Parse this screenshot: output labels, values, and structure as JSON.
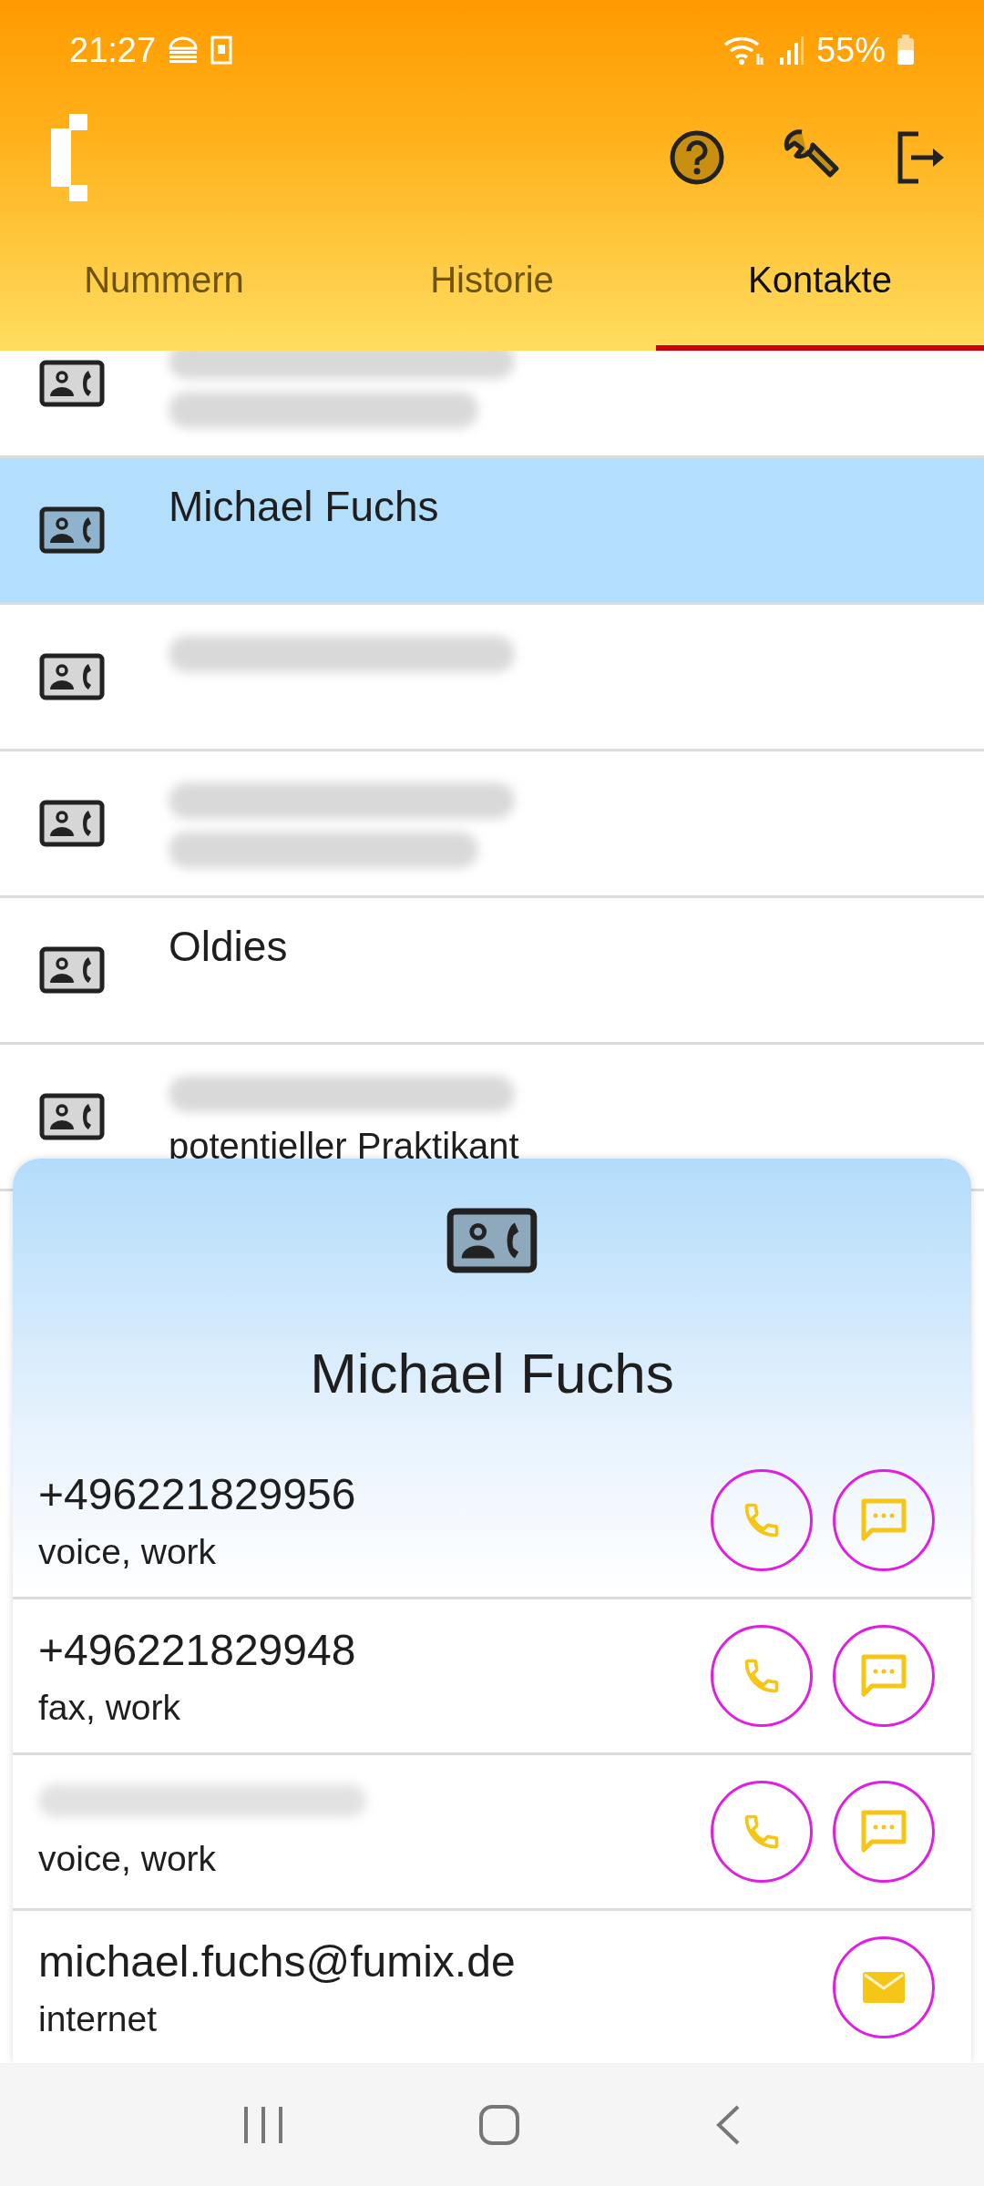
{
  "status_bar": {
    "time": "21:27",
    "battery": "55%"
  },
  "tabs": [
    {
      "label": "Nummern",
      "selected": false
    },
    {
      "label": "Historie",
      "selected": false
    },
    {
      "label": "Kontakte",
      "selected": true
    }
  ],
  "contacts": [
    {
      "selected": false,
      "lines": [
        {
          "kind": "blurred"
        },
        {
          "kind": "blurred"
        }
      ]
    },
    {
      "selected": true,
      "lines": [
        {
          "kind": "text",
          "text": "Michael Fuchs"
        }
      ]
    },
    {
      "selected": false,
      "lines": [
        {
          "kind": "blurred"
        }
      ]
    },
    {
      "selected": false,
      "lines": [
        {
          "kind": "blurred"
        },
        {
          "kind": "blurred"
        }
      ]
    },
    {
      "selected": false,
      "lines": [
        {
          "kind": "text",
          "text": "Oldies"
        }
      ]
    },
    {
      "selected": false,
      "lines": [
        {
          "kind": "blurred"
        },
        {
          "kind": "text",
          "text": "potentieller Praktikant"
        }
      ]
    }
  ],
  "detail": {
    "name": "Michael Fuchs",
    "entries": [
      {
        "value": {
          "kind": "text",
          "text": "+496221829956"
        },
        "type": "voice, work",
        "actions": [
          {
            "kind": "call"
          },
          {
            "kind": "sms"
          }
        ]
      },
      {
        "value": {
          "kind": "text",
          "text": "+496221829948"
        },
        "type": "fax, work",
        "actions": [
          {
            "kind": "call"
          },
          {
            "kind": "sms"
          }
        ]
      },
      {
        "value": {
          "kind": "blurred"
        },
        "type": "voice, work",
        "actions": [
          {
            "kind": "call"
          },
          {
            "kind": "sms"
          }
        ]
      },
      {
        "value": {
          "kind": "text",
          "text": "michael.fuchs@fumix.de"
        },
        "type": "internet",
        "actions": [
          {
            "kind": "mail"
          }
        ]
      }
    ]
  }
}
